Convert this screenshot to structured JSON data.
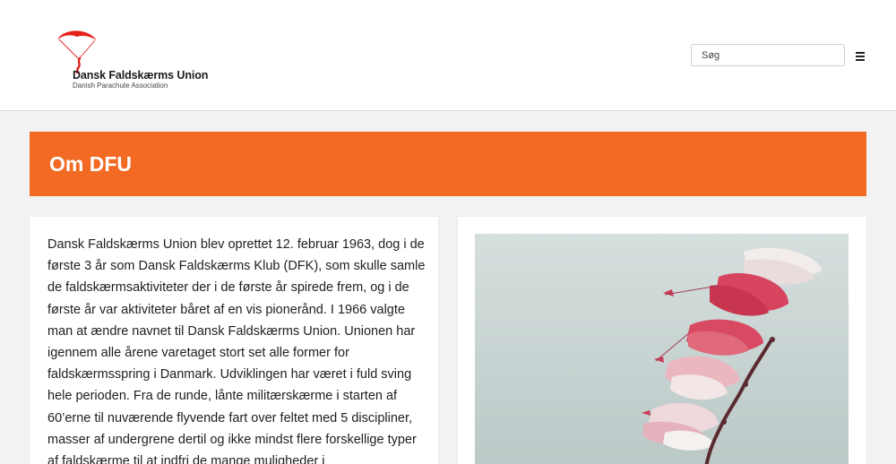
{
  "header": {
    "logo": {
      "name": "Dansk Faldskærms Union",
      "subtitle": "Danish Parachute Association",
      "icon": "parachute-logo-icon",
      "colors": {
        "canopy": "#e4201b",
        "jumper": "#e4201b"
      }
    },
    "search": {
      "placeholder": "Søg",
      "value": ""
    },
    "menu_icon": "hamburger-menu-icon"
  },
  "banner": {
    "title": "Om DFU",
    "color": "#f26a23"
  },
  "article": {
    "text": "Dansk Faldskærms Union blev oprettet 12. februar 1963, dog i de første 3 år som Dansk Faldskærms Klub (DFK), som skulle samle de faldskærmsaktiviteter der i de første år spirede frem, og i de første år var aktiviteter båret af en vis pionerånd. I 1966 valgte man at ændre navnet til Dansk Faldskærms Union. Unionen har igennem alle årene varetaget stort set alle former for faldskærmsspring i Danmark. Udviklingen har været i fuld sving hele perioden. Fra de runde, lånte militærskærme i starten af 60’erne til nuværende flyvende fart over feltet med 5 discipliner, masser af undergrene dertil og ikke mindst flere forskellige typer af faldskærme til at indfri de mange muligheder i"
  },
  "photo": {
    "subject": "parachute-canopy-stack-photo",
    "colors": {
      "sky": "#c9d6d5",
      "canopy_red": "#d8405a",
      "canopy_pink": "#eba5b0",
      "canopy_white": "#f2eeec"
    }
  }
}
